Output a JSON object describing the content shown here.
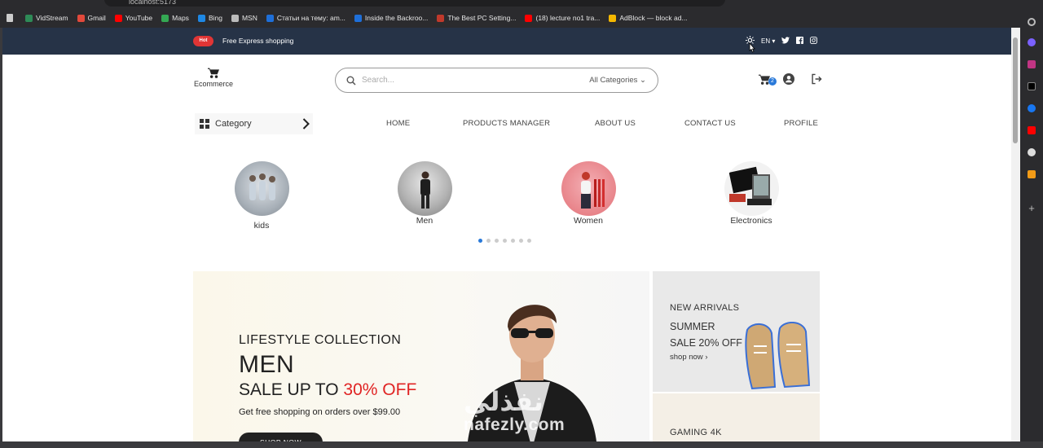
{
  "browser": {
    "url": "localhost:5173",
    "bookmarks": [
      {
        "label": "VidStream",
        "color": "#2e8b57"
      },
      {
        "label": "Gmail",
        "color": "#e2493b"
      },
      {
        "label": "YouTube",
        "color": "#ff0000"
      },
      {
        "label": "Maps",
        "color": "#34a853"
      },
      {
        "label": "Bing",
        "color": "#1e88e5"
      },
      {
        "label": "MSN",
        "color": "#bbbbbb"
      },
      {
        "label": "Статьи на тему: am...",
        "color": "#1e6fd9"
      },
      {
        "label": "Inside the Backroo...",
        "color": "#1e6fd9"
      },
      {
        "label": "The Best PC Setting...",
        "color": "#c0392b"
      },
      {
        "label": "(18) lecture no1 tra...",
        "color": "#ff0000"
      },
      {
        "label": "AdBlock — block ad...",
        "color": "#f5b800"
      }
    ]
  },
  "topbar": {
    "badge": "Hot",
    "promo": "Free Express shopping",
    "language": "EN"
  },
  "header": {
    "logo": "Ecommerce",
    "search_placeholder": "Search...",
    "category_select": "All Categories",
    "cart_count": "2"
  },
  "nav": {
    "category_button": "Category",
    "links": [
      "HOME",
      "PRODUCTS MANAGER",
      "ABOUT US",
      "CONTACT US",
      "PROFILE"
    ]
  },
  "categories": [
    {
      "label": "kids",
      "color": "#9aa3ad"
    },
    {
      "label": "Men",
      "color": "#8a8f96"
    },
    {
      "label": "Women",
      "color": "#e8848a"
    },
    {
      "label": "Electronics",
      "color": "#3a3a3a"
    }
  ],
  "carousel": {
    "dots": 7,
    "active": 0
  },
  "hero": {
    "kicker": "LIFESTYLE COLLECTION",
    "title": "MEN",
    "sale_prefix": "SALE UP TO",
    "sale_highlight": "30% OFF",
    "sub": "Get free shopping on orders over $99.00",
    "button": "SHOP NOW"
  },
  "side_cards": [
    {
      "kicker": "NEW ARRIVALS",
      "line1": "SUMMER",
      "line2": "SALE 20% OFF",
      "link": "shop now"
    },
    {
      "kicker": "GAMING 4K"
    }
  ],
  "watermark": {
    "arabic": "نفذلي",
    "latin": "nafezly.com"
  },
  "colors": {
    "topbar": "#263347",
    "accent": "#2979d9",
    "sale": "#e02424",
    "hot": "#e03535"
  }
}
